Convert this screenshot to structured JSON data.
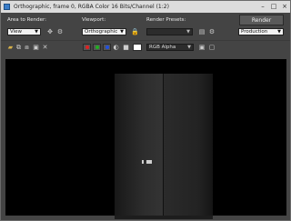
{
  "window": {
    "title": "Orthographic, frame 0, RGBA Color 16 Bits/Channel (1:2)"
  },
  "area_to_render": {
    "label": "Area to Render:",
    "value": "View"
  },
  "viewport_select": {
    "label": "Viewport:",
    "value": "Orthographic"
  },
  "render_presets": {
    "label": "Render Presets:",
    "value": ""
  },
  "render_button": {
    "label": "Render"
  },
  "production_select": {
    "value": "Production"
  },
  "channel_select": {
    "value": "RGB Alpha"
  },
  "colors": {
    "red": "#e02020",
    "green": "#20b020",
    "blue": "#2050e0",
    "white": "#ffffff"
  }
}
